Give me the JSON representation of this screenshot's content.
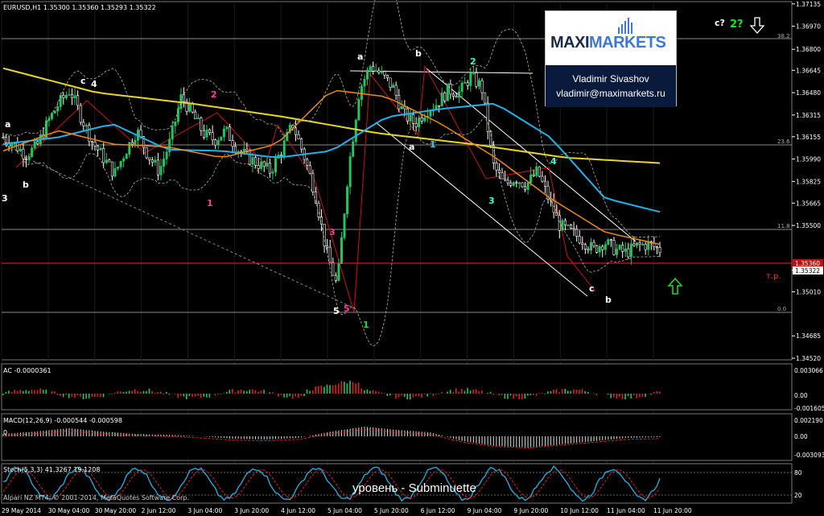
{
  "main_title": "EURUSD,H1  1.35300 1.35360 1.35293 1.35322",
  "price_axis": [
    "1.37135",
    "1.36970",
    "1.36800",
    "1.36645",
    "1.36480",
    "1.36315",
    "1.36155",
    "1.35990",
    "1.35825",
    "1.35665",
    "1.35500",
    "1.35170",
    "1.35010",
    "1.34685",
    "1.34520"
  ],
  "current_price": "1.35322",
  "tp_price": "1.35360",
  "fib_levels": [
    "38.2",
    "23.6",
    "11.8",
    "0.0"
  ],
  "tp_label": "т.р.",
  "corner_marks": {
    "c": "c?",
    "two": "2?"
  },
  "time_axis": [
    "29 May 2014",
    "30 May 04:00",
    "30 May 20:00",
    "2 Jun 12:00",
    "3 Jun 04:00",
    "3 Jun 20:00",
    "4 Jun 12:00",
    "5 Jun 04:00",
    "5 Jun 20:00",
    "6 Jun 12:00",
    "9 Jun 04:00",
    "9 Jun 20:00",
    "10 Jun 12:00",
    "11 Jun 04:00",
    "11 Jun 20:00"
  ],
  "ac_panel": {
    "title": "AC -0.0000361",
    "axis": [
      "0.003066",
      "0.00",
      "-0.001605"
    ]
  },
  "macd_panel": {
    "title": "MACD(12,26,9) -0.000544 -0.000598",
    "axis": [
      "0.002190",
      "0.00",
      "-0.003093"
    ],
    "zero_mark": "0"
  },
  "stoch_panel": {
    "title": "Stoch(5,3,3) 41.3267 19.1208",
    "axis": [
      "80",
      "20"
    ]
  },
  "copyright": "Alpari NZ MT4, © 2001-2014, MetaQuotes Software Corp.",
  "logo": {
    "brand_a": "MAXI",
    "brand_b": "MARKETS",
    "name": "Vladimir Sivashov",
    "email": "vladimir@maximarkets.ru"
  },
  "caption": "уровень - Subminuette",
  "waves": [
    {
      "t": "a",
      "c": "#ffffff"
    },
    {
      "t": "b",
      "c": "#ffffff"
    },
    {
      "t": "3",
      "c": "#ffffff"
    },
    {
      "t": "c",
      "c": "#ffffff"
    },
    {
      "t": "4",
      "c": "#ffffff"
    },
    {
      "t": "2",
      "c": "#ff3fa0"
    },
    {
      "t": "1",
      "c": "#ff3fa0"
    },
    {
      "t": "a",
      "c": "#ffffff"
    },
    {
      "t": "b",
      "c": "#ffffff"
    },
    {
      "t": "2",
      "c": "#33ffcc"
    },
    {
      "t": "1",
      "c": "#33ccff"
    },
    {
      "t": "a",
      "c": "#ffffff"
    },
    {
      "t": "3",
      "c": "#33ffcc"
    },
    {
      "t": "4",
      "c": "#33ffcc"
    },
    {
      "t": "c",
      "c": "#ffffff"
    },
    {
      "t": "b",
      "c": "#ffffff"
    },
    {
      "t": "5",
      "c": "#ffffff"
    },
    {
      "t": "1",
      "c": "#22dd22"
    },
    {
      "t": "3",
      "c": "#ff3fa0"
    },
    {
      "t": "5",
      "c": "#ff3fa0"
    }
  ],
  "colors": {
    "ma_slow": "#e8d820",
    "ma_mid": "#1eb4e8",
    "ma_fast": "#f08a10",
    "bull": "#22c55e",
    "bear": "#ffffff",
    "hline": "#ff2020",
    "wave_line": "#d01010"
  },
  "chart_data": {
    "type": "candlestick",
    "symbol": "EURUSD",
    "timeframe": "H1",
    "ylim": [
      1.3452,
      1.3714
    ],
    "close_path": [
      1.3615,
      1.361,
      1.3602,
      1.3608,
      1.3626,
      1.364,
      1.365,
      1.363,
      1.3612,
      1.36,
      1.3588,
      1.3605,
      1.362,
      1.3602,
      1.359,
      1.3612,
      1.3645,
      1.3632,
      1.3618,
      1.3613,
      1.362,
      1.3607,
      1.36,
      1.3595,
      1.359,
      1.3605,
      1.3625,
      1.3602,
      1.3575,
      1.3532,
      1.3505,
      1.359,
      1.365,
      1.3668,
      1.3661,
      1.3652,
      1.3632,
      1.3625,
      1.3635,
      1.364,
      1.365,
      1.3648,
      1.366,
      1.3652,
      1.3595,
      1.358,
      1.3585,
      1.358,
      1.359,
      1.357,
      1.355,
      1.3545,
      1.354,
      1.3532,
      1.3538,
      1.3532,
      1.353,
      1.3535,
      1.3536,
      1.3532
    ],
    "ma_slow": [
      1.3666,
      1.3648,
      1.364,
      1.363,
      1.3618,
      1.361,
      1.36,
      1.3596
    ],
    "ma_mid": [
      1.361,
      1.3615,
      1.3625,
      1.3606,
      1.3605,
      1.36,
      1.3605,
      1.363,
      1.3636,
      1.364,
      1.3615,
      1.357,
      1.356
    ],
    "ma_fast": [
      1.3605,
      1.362,
      1.361,
      1.3608,
      1.36,
      1.361,
      1.365,
      1.3645,
      1.3625,
      1.36,
      1.357,
      1.3545,
      1.3536
    ],
    "fib_retracement": [
      "38.2",
      "23.6",
      "11.8",
      "0.0"
    ]
  }
}
